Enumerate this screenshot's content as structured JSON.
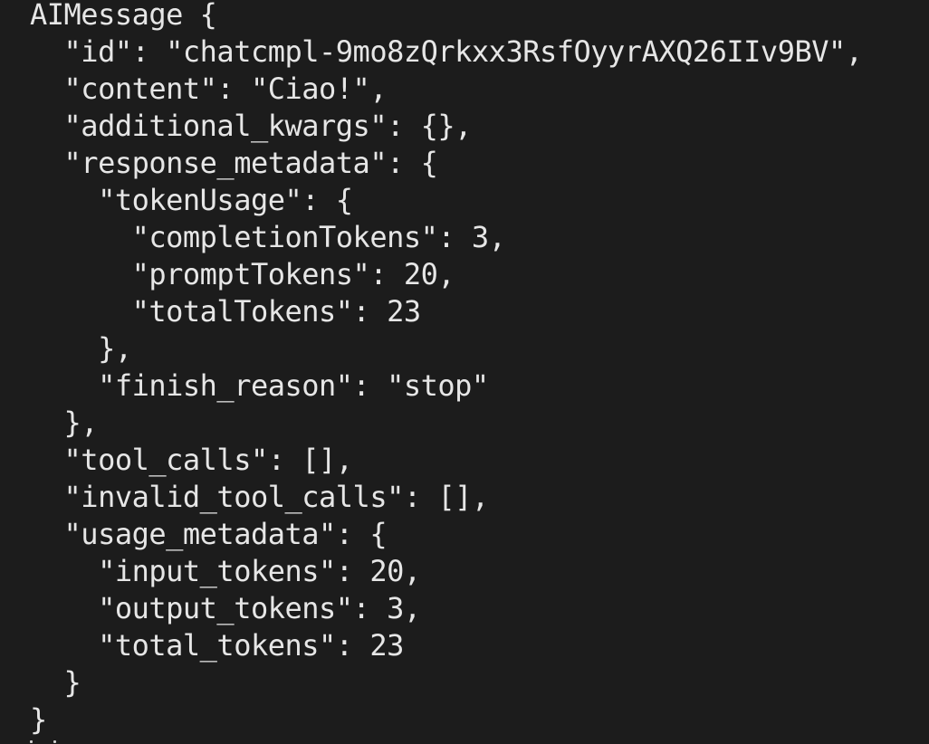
{
  "terminal": {
    "lines": [
      "AIMessage {",
      "  \"id\": \"chatcmpl-9mo8zQrkxx3RsfOyyrAXQ26IIv9BV\",",
      "  \"content\": \"Ciao!\",",
      "  \"additional_kwargs\": {},",
      "  \"response_metadata\": {",
      "    \"tokenUsage\": {",
      "      \"completionTokens\": 3,",
      "      \"promptTokens\": 20,",
      "      \"totalTokens\": 23",
      "    },",
      "    \"finish_reason\": \"stop\"",
      "  },",
      "  \"tool_calls\": [],",
      "  \"invalid_tool_calls\": [],",
      "  \"usage_metadata\": {",
      "    \"input_tokens\": 20,",
      "    \"output_tokens\": 3,",
      "    \"total_tokens\": 23",
      "  }",
      "}"
    ]
  },
  "colors": {
    "background": "#1c1c1c",
    "text": "#e6e6e6"
  }
}
